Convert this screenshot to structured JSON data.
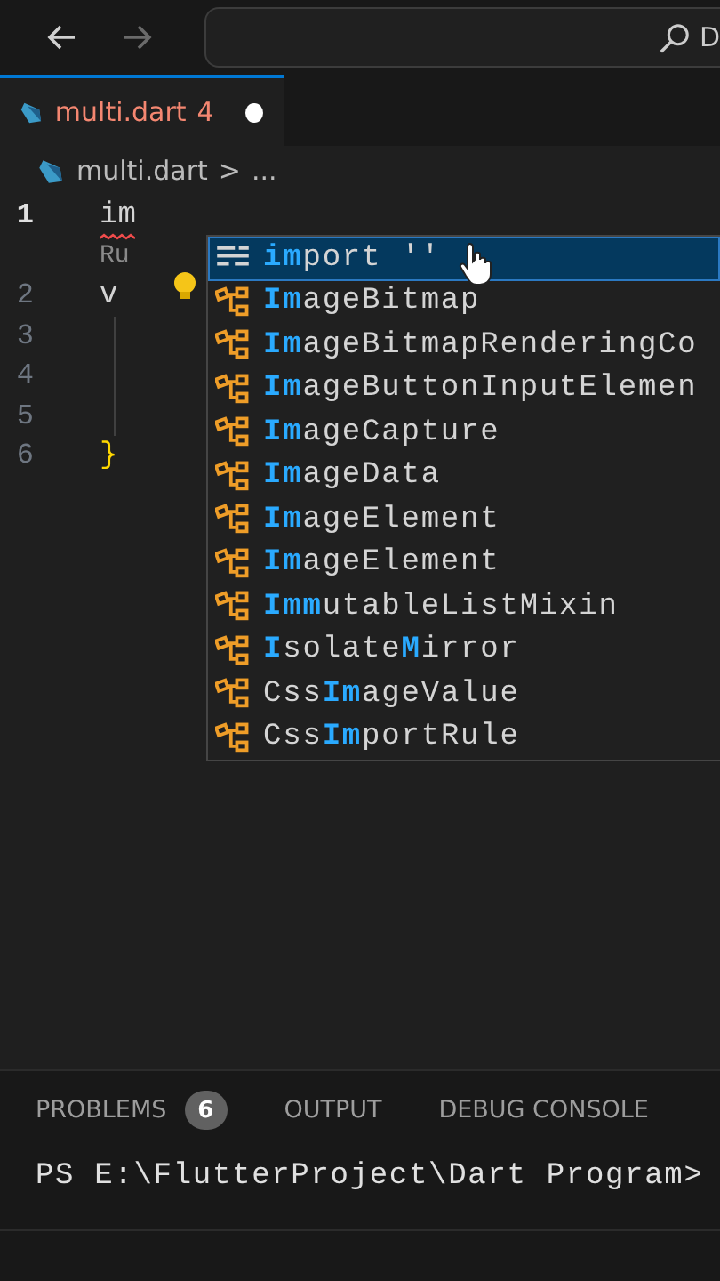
{
  "title_bar": {
    "command_center": {
      "text": "D"
    }
  },
  "tabs": [
    {
      "label": "multi.dart",
      "problems": "4",
      "has_errors": true,
      "modified": true,
      "selected": true
    }
  ],
  "breadcrumb": {
    "items": [
      "multi.dart",
      "..."
    ],
    "separator": ">"
  },
  "editor": {
    "lines": [
      {
        "number": "1",
        "text": "im",
        "kind": "code",
        "current": true,
        "error": true
      },
      {
        "number": "2",
        "text": "v",
        "kind": "code",
        "current": false,
        "error": false
      },
      {
        "number": "3",
        "kind": "blank",
        "current": false,
        "error": false
      },
      {
        "number": "4",
        "kind": "blank",
        "current": false,
        "error": false
      },
      {
        "number": "5",
        "kind": "blank",
        "current": false,
        "error": false
      },
      {
        "number": "6",
        "text": "}",
        "kind": "bracket",
        "current": false,
        "error": false
      }
    ],
    "codelens": "Ru"
  },
  "suggestions": [
    {
      "kind": "keyword",
      "selected": true,
      "parts": [
        {
          "text": "im",
          "match": true
        },
        {
          "text": "port ''",
          "match": false
        }
      ]
    },
    {
      "kind": "class",
      "selected": false,
      "parts": [
        {
          "text": "Im",
          "match": true
        },
        {
          "text": "ageBitmap",
          "match": false
        }
      ]
    },
    {
      "kind": "class",
      "selected": false,
      "parts": [
        {
          "text": "Im",
          "match": true
        },
        {
          "text": "ageBitmapRenderingCo",
          "match": false
        }
      ]
    },
    {
      "kind": "class",
      "selected": false,
      "parts": [
        {
          "text": "Im",
          "match": true
        },
        {
          "text": "ageButtonInputElemen",
          "match": false
        }
      ]
    },
    {
      "kind": "class",
      "selected": false,
      "parts": [
        {
          "text": "Im",
          "match": true
        },
        {
          "text": "ageCapture",
          "match": false
        }
      ]
    },
    {
      "kind": "class",
      "selected": false,
      "parts": [
        {
          "text": "Im",
          "match": true
        },
        {
          "text": "ageData",
          "match": false
        }
      ]
    },
    {
      "kind": "class",
      "selected": false,
      "parts": [
        {
          "text": "Im",
          "match": true
        },
        {
          "text": "ageElement",
          "match": false
        }
      ]
    },
    {
      "kind": "class",
      "selected": false,
      "parts": [
        {
          "text": "Im",
          "match": true
        },
        {
          "text": "ageElement",
          "match": false
        }
      ]
    },
    {
      "kind": "class",
      "selected": false,
      "parts": [
        {
          "text": "Imm",
          "match": true
        },
        {
          "text": "utableListMixin",
          "match": false
        }
      ]
    },
    {
      "kind": "class",
      "selected": false,
      "parts": [
        {
          "text": "I",
          "match": true
        },
        {
          "text": "solate",
          "match": false
        },
        {
          "text": "M",
          "match": true
        },
        {
          "text": "irror",
          "match": false
        }
      ]
    },
    {
      "kind": "class",
      "selected": false,
      "parts": [
        {
          "text": "Css",
          "match": false
        },
        {
          "text": "Im",
          "match": true
        },
        {
          "text": "ageValue",
          "match": false
        }
      ]
    },
    {
      "kind": "class",
      "selected": false,
      "parts": [
        {
          "text": "Css",
          "match": false
        },
        {
          "text": "Im",
          "match": true
        },
        {
          "text": "portRule",
          "match": false
        }
      ]
    }
  ],
  "panel": {
    "tabs": [
      {
        "label": "PROBLEMS",
        "badge": "6",
        "selected": false
      },
      {
        "label": "OUTPUT",
        "selected": false
      },
      {
        "label": "DEBUG CONSOLE",
        "selected": false
      }
    ],
    "terminal": [
      "PS E:\\FlutterProject\\Dart Program>"
    ]
  }
}
